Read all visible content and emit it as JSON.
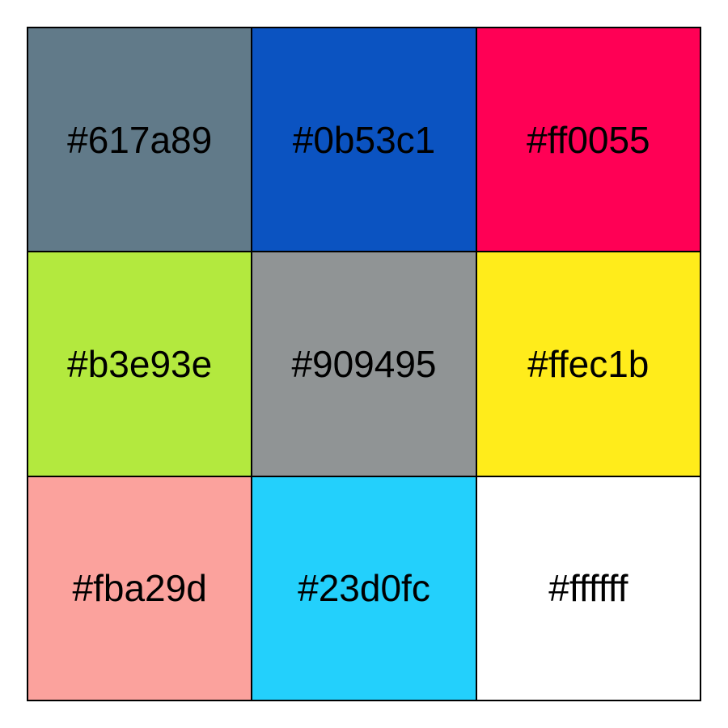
{
  "swatches": [
    {
      "label": "#617a89",
      "color": "#617a89"
    },
    {
      "label": "#0b53c1",
      "color": "#0b53c1"
    },
    {
      "label": "#ff0055",
      "color": "#ff0055"
    },
    {
      "label": "#b3e93e",
      "color": "#b3e93e"
    },
    {
      "label": "#909495",
      "color": "#909495"
    },
    {
      "label": "#ffec1b",
      "color": "#ffec1b"
    },
    {
      "label": "#fba29d",
      "color": "#fba29d"
    },
    {
      "label": "#23d0fc",
      "color": "#23d0fc"
    },
    {
      "label": "#ffffff",
      "color": "#ffffff"
    }
  ]
}
